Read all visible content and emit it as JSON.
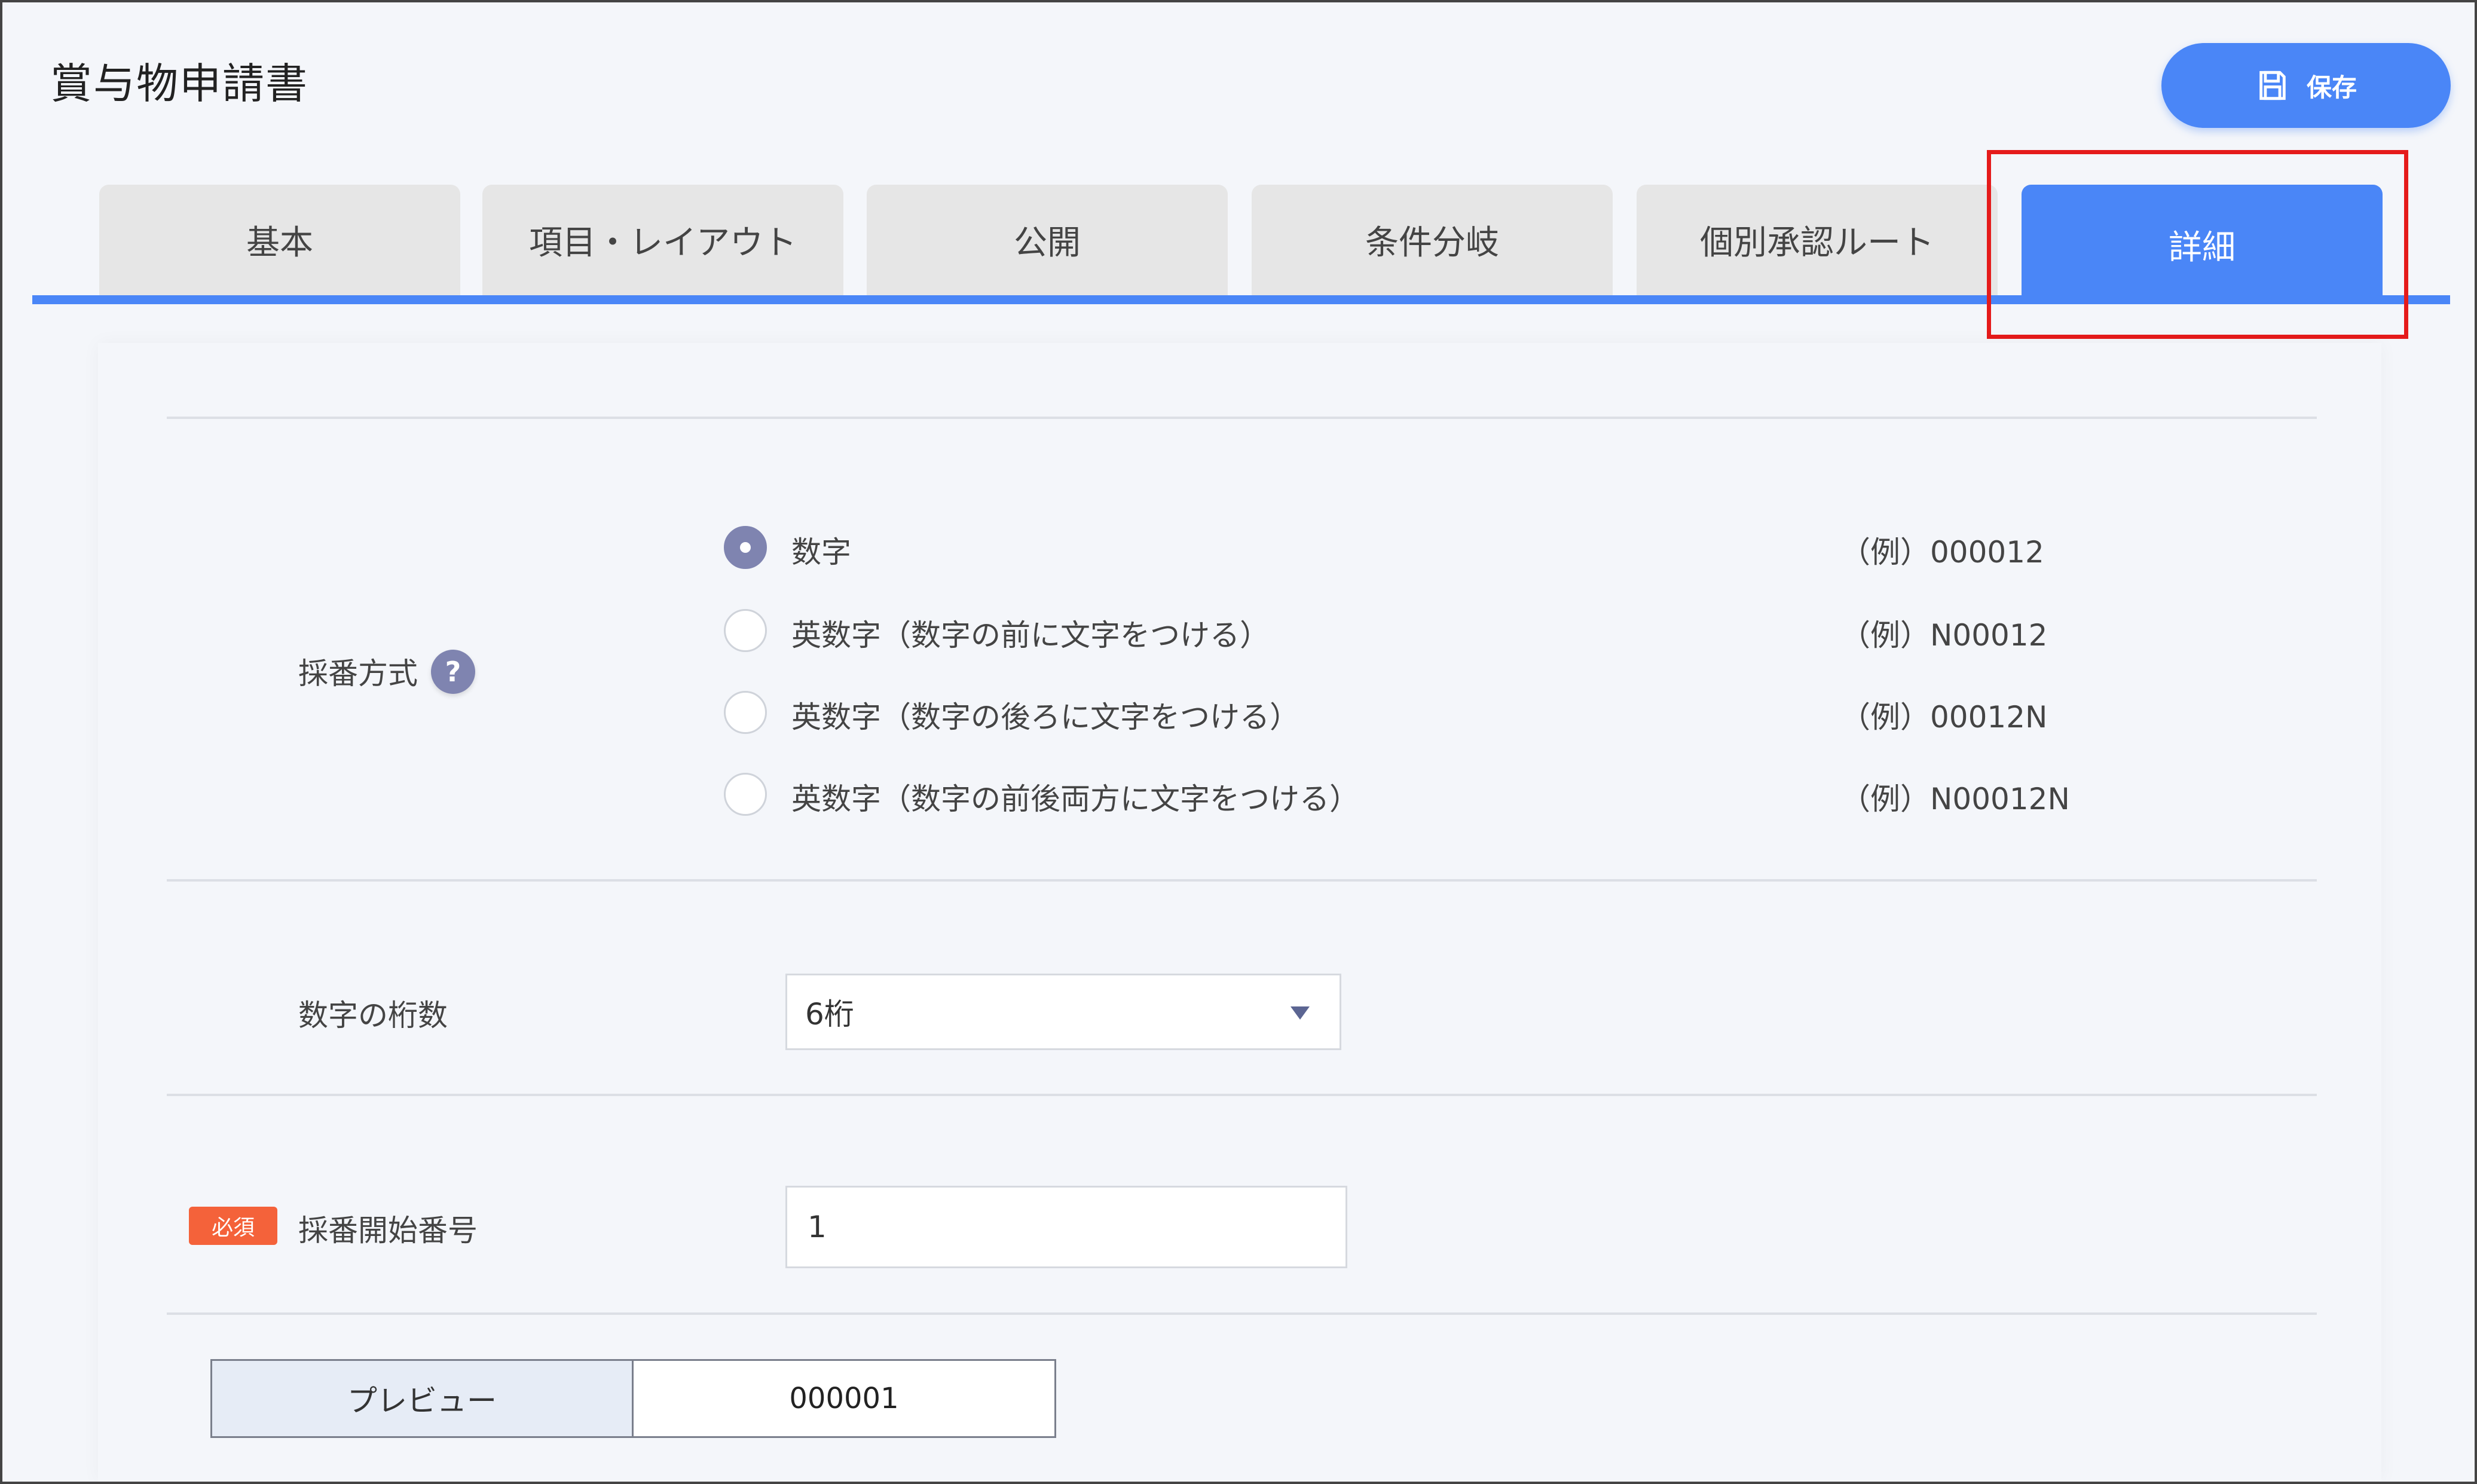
{
  "header": {
    "title": "賞与物申請書",
    "save_label": "保存"
  },
  "tabs": [
    {
      "label": "基本",
      "active": false
    },
    {
      "label": "項目・レイアウト",
      "active": false
    },
    {
      "label": "公開",
      "active": false
    },
    {
      "label": "条件分岐",
      "active": false
    },
    {
      "label": "個別承認ルート",
      "active": false
    },
    {
      "label": "詳細",
      "active": true
    }
  ],
  "numbering": {
    "label": "採番方式",
    "help_icon": "?",
    "options": [
      {
        "label": "数字",
        "example": "（例）000012",
        "checked": true
      },
      {
        "label": "英数字（数字の前に文字をつける）",
        "example": "（例）N00012",
        "checked": false
      },
      {
        "label": "英数字（数字の後ろに文字をつける）",
        "example": "（例）00012N",
        "checked": false
      },
      {
        "label": "英数字（数字の前後両方に文字をつける）",
        "example": "（例）N00012N",
        "checked": false
      }
    ]
  },
  "digits": {
    "label": "数字の桁数",
    "selected": "6桁"
  },
  "start_number": {
    "required_badge": "必須",
    "label": "採番開始番号",
    "value": "1"
  },
  "preview": {
    "label": "プレビュー",
    "value": "000001"
  },
  "colors": {
    "accent": "#4a86f7",
    "highlight": "#e51b1b",
    "required": "#f4623a",
    "radio_checked": "#7f84b0"
  }
}
